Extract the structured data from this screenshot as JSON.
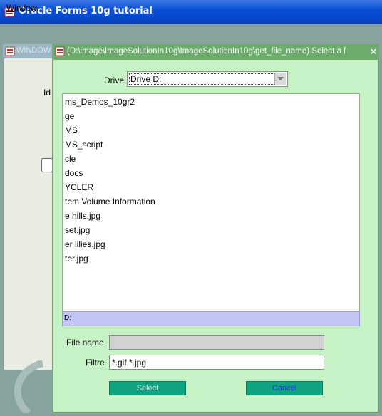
{
  "app": {
    "title": "Oracle Forms 10g tutorial"
  },
  "menu": {
    "window_prefix": "W",
    "window_rest": "indow"
  },
  "background_window": {
    "title": "WINDOW",
    "id_label": "Id"
  },
  "dialog": {
    "title": "(D:\\image\\ImageSolutionIn10g\\ImageSolutionIn10g\\get_file_name)  Select a f",
    "close_glyph": "×",
    "drive_label": "Drive",
    "drive_value": "Drive D:",
    "files": [
      "ms_Demos_10gr2",
      "ge",
      "MS",
      "MS_script",
      "cle",
      "docs",
      "YCLER",
      "tem Volume Information",
      "e hills.jpg",
      "set.jpg",
      "er lilies.jpg",
      "ter.jpg"
    ],
    "path": "D:",
    "file_name_label": "File name",
    "file_name_value": "",
    "filter_label": "Filtre",
    "filter_value": "*.gif,*.jpg",
    "select_label": "Select",
    "cancel_label": "Cancel"
  },
  "icons": {
    "app": "oracle-forms-icon",
    "window": "window-icon",
    "close": "close-icon",
    "dropdown": "chevron-down-icon"
  }
}
